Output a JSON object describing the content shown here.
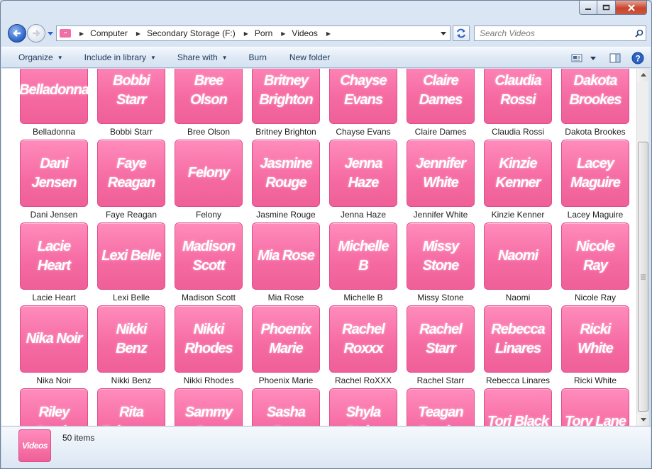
{
  "window": {
    "caption_buttons": [
      "minimize-icon",
      "maximize-icon",
      "close-icon"
    ]
  },
  "address": {
    "breadcrumbs": [
      "Computer",
      "Secondary Storage (F:)",
      "Porn",
      "Videos"
    ]
  },
  "search": {
    "placeholder": "Search Videos"
  },
  "toolbar": {
    "organize": "Organize",
    "include": "Include in library",
    "share": "Share with",
    "burn": "Burn",
    "new_folder": "New folder"
  },
  "items": [
    {
      "thumb": "Belladonna",
      "label": "Belladonna"
    },
    {
      "thumb": "Bobbi Starr",
      "label": "Bobbi Starr"
    },
    {
      "thumb": "Bree Olson",
      "label": "Bree Olson"
    },
    {
      "thumb": "Britney Brighton",
      "label": "Britney Brighton"
    },
    {
      "thumb": "Chayse Evans",
      "label": "Chayse Evans"
    },
    {
      "thumb": "Claire Dames",
      "label": "Claire Dames"
    },
    {
      "thumb": "Claudia Rossi",
      "label": "Claudia Rossi"
    },
    {
      "thumb": "Dakota Brookes",
      "label": "Dakota Brookes"
    },
    {
      "thumb": "Dani Jensen",
      "label": "Dani Jensen"
    },
    {
      "thumb": "Faye Reagan",
      "label": "Faye Reagan"
    },
    {
      "thumb": "Felony",
      "label": "Felony"
    },
    {
      "thumb": "Jasmine Rouge",
      "label": "Jasmine Rouge"
    },
    {
      "thumb": "Jenna Haze",
      "label": "Jenna Haze"
    },
    {
      "thumb": "Jennifer White",
      "label": "Jennifer White"
    },
    {
      "thumb": "Kinzie Kenner",
      "label": "Kinzie Kenner"
    },
    {
      "thumb": "Lacey Maguire",
      "label": "Lacey Maguire"
    },
    {
      "thumb": "Lacie Heart",
      "label": "Lacie Heart"
    },
    {
      "thumb": "Lexi Belle",
      "label": "Lexi Belle"
    },
    {
      "thumb": "Madison Scott",
      "label": "Madison Scott"
    },
    {
      "thumb": "Mia Rose",
      "label": "Mia Rose"
    },
    {
      "thumb": "Michelle B",
      "label": "Michelle B"
    },
    {
      "thumb": "Missy Stone",
      "label": "Missy Stone"
    },
    {
      "thumb": "Naomi",
      "label": "Naomi"
    },
    {
      "thumb": "Nicole Ray",
      "label": "Nicole Ray"
    },
    {
      "thumb": "Nika Noir",
      "label": "Nika Noir"
    },
    {
      "thumb": "Nikki Benz",
      "label": "Nikki Benz"
    },
    {
      "thumb": "Nikki Rhodes",
      "label": "Nikki Rhodes"
    },
    {
      "thumb": "Phoenix Marie",
      "label": "Phoenix Marie"
    },
    {
      "thumb": "Rachel Roxxx",
      "label": "Rachel RoXXX"
    },
    {
      "thumb": "Rachel Starr",
      "label": "Rachel Starr"
    },
    {
      "thumb": "Rebecca Linares",
      "label": "Rebecca Linares"
    },
    {
      "thumb": "Ricki White",
      "label": "Ricki White"
    },
    {
      "thumb": "Riley Steele",
      "label": ""
    },
    {
      "thumb": "Rita Faltoyano",
      "label": ""
    },
    {
      "thumb": "Sammy Cruz",
      "label": ""
    },
    {
      "thumb": "Sasha Grey",
      "label": ""
    },
    {
      "thumb": "Shyla Stylez",
      "label": ""
    },
    {
      "thumb": "Teagan Presley",
      "label": ""
    },
    {
      "thumb": "Tori Black",
      "label": ""
    },
    {
      "thumb": "Tory Lane",
      "label": ""
    }
  ],
  "details": {
    "thumb": "Videos",
    "count": "50 items"
  },
  "colors": {
    "thumb_pink": "#f56aa2",
    "toolbar_text": "#1e395b"
  }
}
